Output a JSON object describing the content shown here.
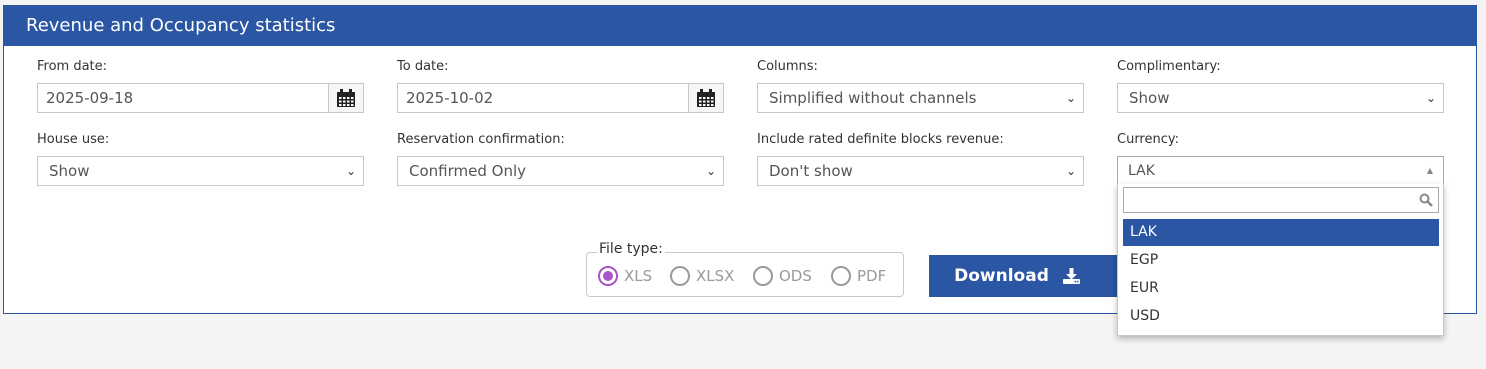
{
  "panel": {
    "title": "Revenue and Occupancy statistics"
  },
  "fields": {
    "from_date": {
      "label": "From date:",
      "value": "2025-09-18"
    },
    "to_date": {
      "label": "To date:",
      "value": "2025-10-02"
    },
    "columns": {
      "label": "Columns:",
      "value": "Simplified without channels"
    },
    "complimentary": {
      "label": "Complimentary:",
      "value": "Show"
    },
    "house_use": {
      "label": "House use:",
      "value": "Show"
    },
    "reservation_confirmation": {
      "label": "Reservation confirmation:",
      "value": "Confirmed Only"
    },
    "rated_blocks": {
      "label": "Include rated definite blocks revenue:",
      "value": "Don't show"
    },
    "currency": {
      "label": "Currency:",
      "value": "LAK"
    }
  },
  "file_type": {
    "legend": "File type:",
    "options": [
      "XLS",
      "XLSX",
      "ODS",
      "PDF"
    ],
    "selected": "XLS"
  },
  "download": {
    "label": "Download"
  },
  "currency_dropdown": {
    "search_placeholder": "",
    "options": [
      "LAK",
      "EGP",
      "EUR",
      "USD"
    ],
    "highlighted": "LAK"
  },
  "colors": {
    "primary": "#2a56a3",
    "radio_accent": "#a855c9"
  }
}
